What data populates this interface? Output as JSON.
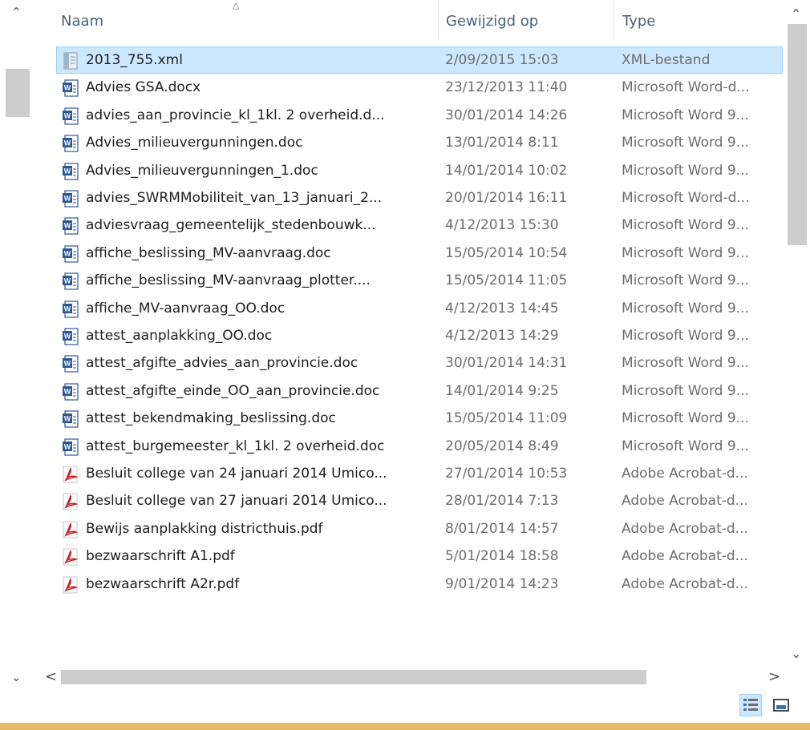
{
  "columns": {
    "name": "Naam",
    "date": "Gewijzigd op",
    "type": "Type"
  },
  "files": [
    {
      "icon": "xml",
      "name": "2013_755.xml",
      "date": "2/09/2015 15:03",
      "type": "XML-bestand",
      "selected": true
    },
    {
      "icon": "word",
      "name": "Advies GSA.docx",
      "date": "23/12/2013 11:40",
      "type": "Microsoft Word-d..."
    },
    {
      "icon": "word",
      "name": "advies_aan_provincie_kl_1kl. 2 overheid.d...",
      "date": "30/01/2014 14:26",
      "type": "Microsoft Word 9..."
    },
    {
      "icon": "word",
      "name": "Advies_milieuvergunningen.doc",
      "date": "13/01/2014 8:11",
      "type": "Microsoft Word 9..."
    },
    {
      "icon": "word",
      "name": "Advies_milieuvergunningen_1.doc",
      "date": "14/01/2014 10:02",
      "type": "Microsoft Word 9..."
    },
    {
      "icon": "word",
      "name": "advies_SWRMMobiliteit_van_13_januari_2...",
      "date": "20/01/2014 16:11",
      "type": "Microsoft Word-d..."
    },
    {
      "icon": "word",
      "name": "adviesvraag_gemeentelijk_stedenbouwk...",
      "date": "4/12/2013 15:30",
      "type": "Microsoft Word 9..."
    },
    {
      "icon": "word",
      "name": "affiche_beslissing_MV-aanvraag.doc",
      "date": "15/05/2014 10:54",
      "type": "Microsoft Word 9..."
    },
    {
      "icon": "word",
      "name": "affiche_beslissing_MV-aanvraag_plotter....",
      "date": "15/05/2014 11:05",
      "type": "Microsoft Word 9..."
    },
    {
      "icon": "word",
      "name": "affiche_MV-aanvraag_OO.doc",
      "date": "4/12/2013 14:45",
      "type": "Microsoft Word 9..."
    },
    {
      "icon": "word",
      "name": "attest_aanplakking_OO.doc",
      "date": "4/12/2013 14:29",
      "type": "Microsoft Word 9..."
    },
    {
      "icon": "word",
      "name": "attest_afgifte_advies_aan_provincie.doc",
      "date": "30/01/2014 14:31",
      "type": "Microsoft Word 9..."
    },
    {
      "icon": "word",
      "name": "attest_afgifte_einde_OO_aan_provincie.doc",
      "date": "14/01/2014 9:25",
      "type": "Microsoft Word 9..."
    },
    {
      "icon": "word",
      "name": "attest_bekendmaking_beslissing.doc",
      "date": "15/05/2014 11:09",
      "type": "Microsoft Word 9..."
    },
    {
      "icon": "word",
      "name": "attest_burgemeester_kl_1kl. 2 overheid.doc",
      "date": "20/05/2014 8:49",
      "type": "Microsoft Word 9..."
    },
    {
      "icon": "pdf",
      "name": "Besluit college van 24 januari 2014 Umico...",
      "date": "27/01/2014 10:53",
      "type": "Adobe Acrobat-d..."
    },
    {
      "icon": "pdf",
      "name": "Besluit college van 27 januari 2014 Umico...",
      "date": "28/01/2014 7:13",
      "type": "Adobe Acrobat-d..."
    },
    {
      "icon": "pdf",
      "name": "Bewijs aanplakking districthuis.pdf",
      "date": "8/01/2014 14:57",
      "type": "Adobe Acrobat-d..."
    },
    {
      "icon": "pdf",
      "name": "bezwaarschrift A1.pdf",
      "date": "5/01/2014 18:58",
      "type": "Adobe Acrobat-d..."
    },
    {
      "icon": "pdf",
      "name": "bezwaarschrift A2r.pdf",
      "date": "9/01/2014 14:23",
      "type": "Adobe Acrobat-d..."
    }
  ],
  "colors": {
    "selection_bg": "#cce8ff",
    "selection_border": "#99d1ff",
    "header_text": "#4c607a",
    "secondary_text": "#6d6d6d",
    "window_border": "#e3b866"
  }
}
